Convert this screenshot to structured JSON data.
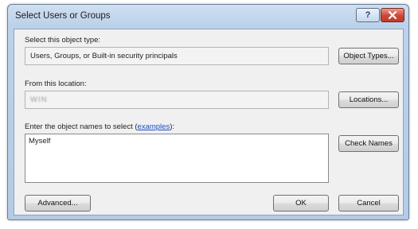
{
  "window": {
    "title": "Select Users or Groups",
    "help_glyph": "?",
    "close_icon": "close-icon"
  },
  "object_type": {
    "label": "Select this object type:",
    "value": "Users, Groups, or Built-in security principals",
    "button": "Object Types..."
  },
  "location": {
    "label": "From this location:",
    "value": "WIN",
    "button": "Locations..."
  },
  "names": {
    "label_prefix": "Enter the object names to select (",
    "label_link": "examples",
    "label_suffix": "):",
    "value": "Myself",
    "check_button": "Check Names"
  },
  "footer": {
    "advanced_button": "Advanced...",
    "ok_button": "OK",
    "cancel_button": "Cancel"
  },
  "colors": {
    "link": "#1a4fc4",
    "close_button": "#c94a38",
    "title_bar": "#bcd2ea"
  }
}
